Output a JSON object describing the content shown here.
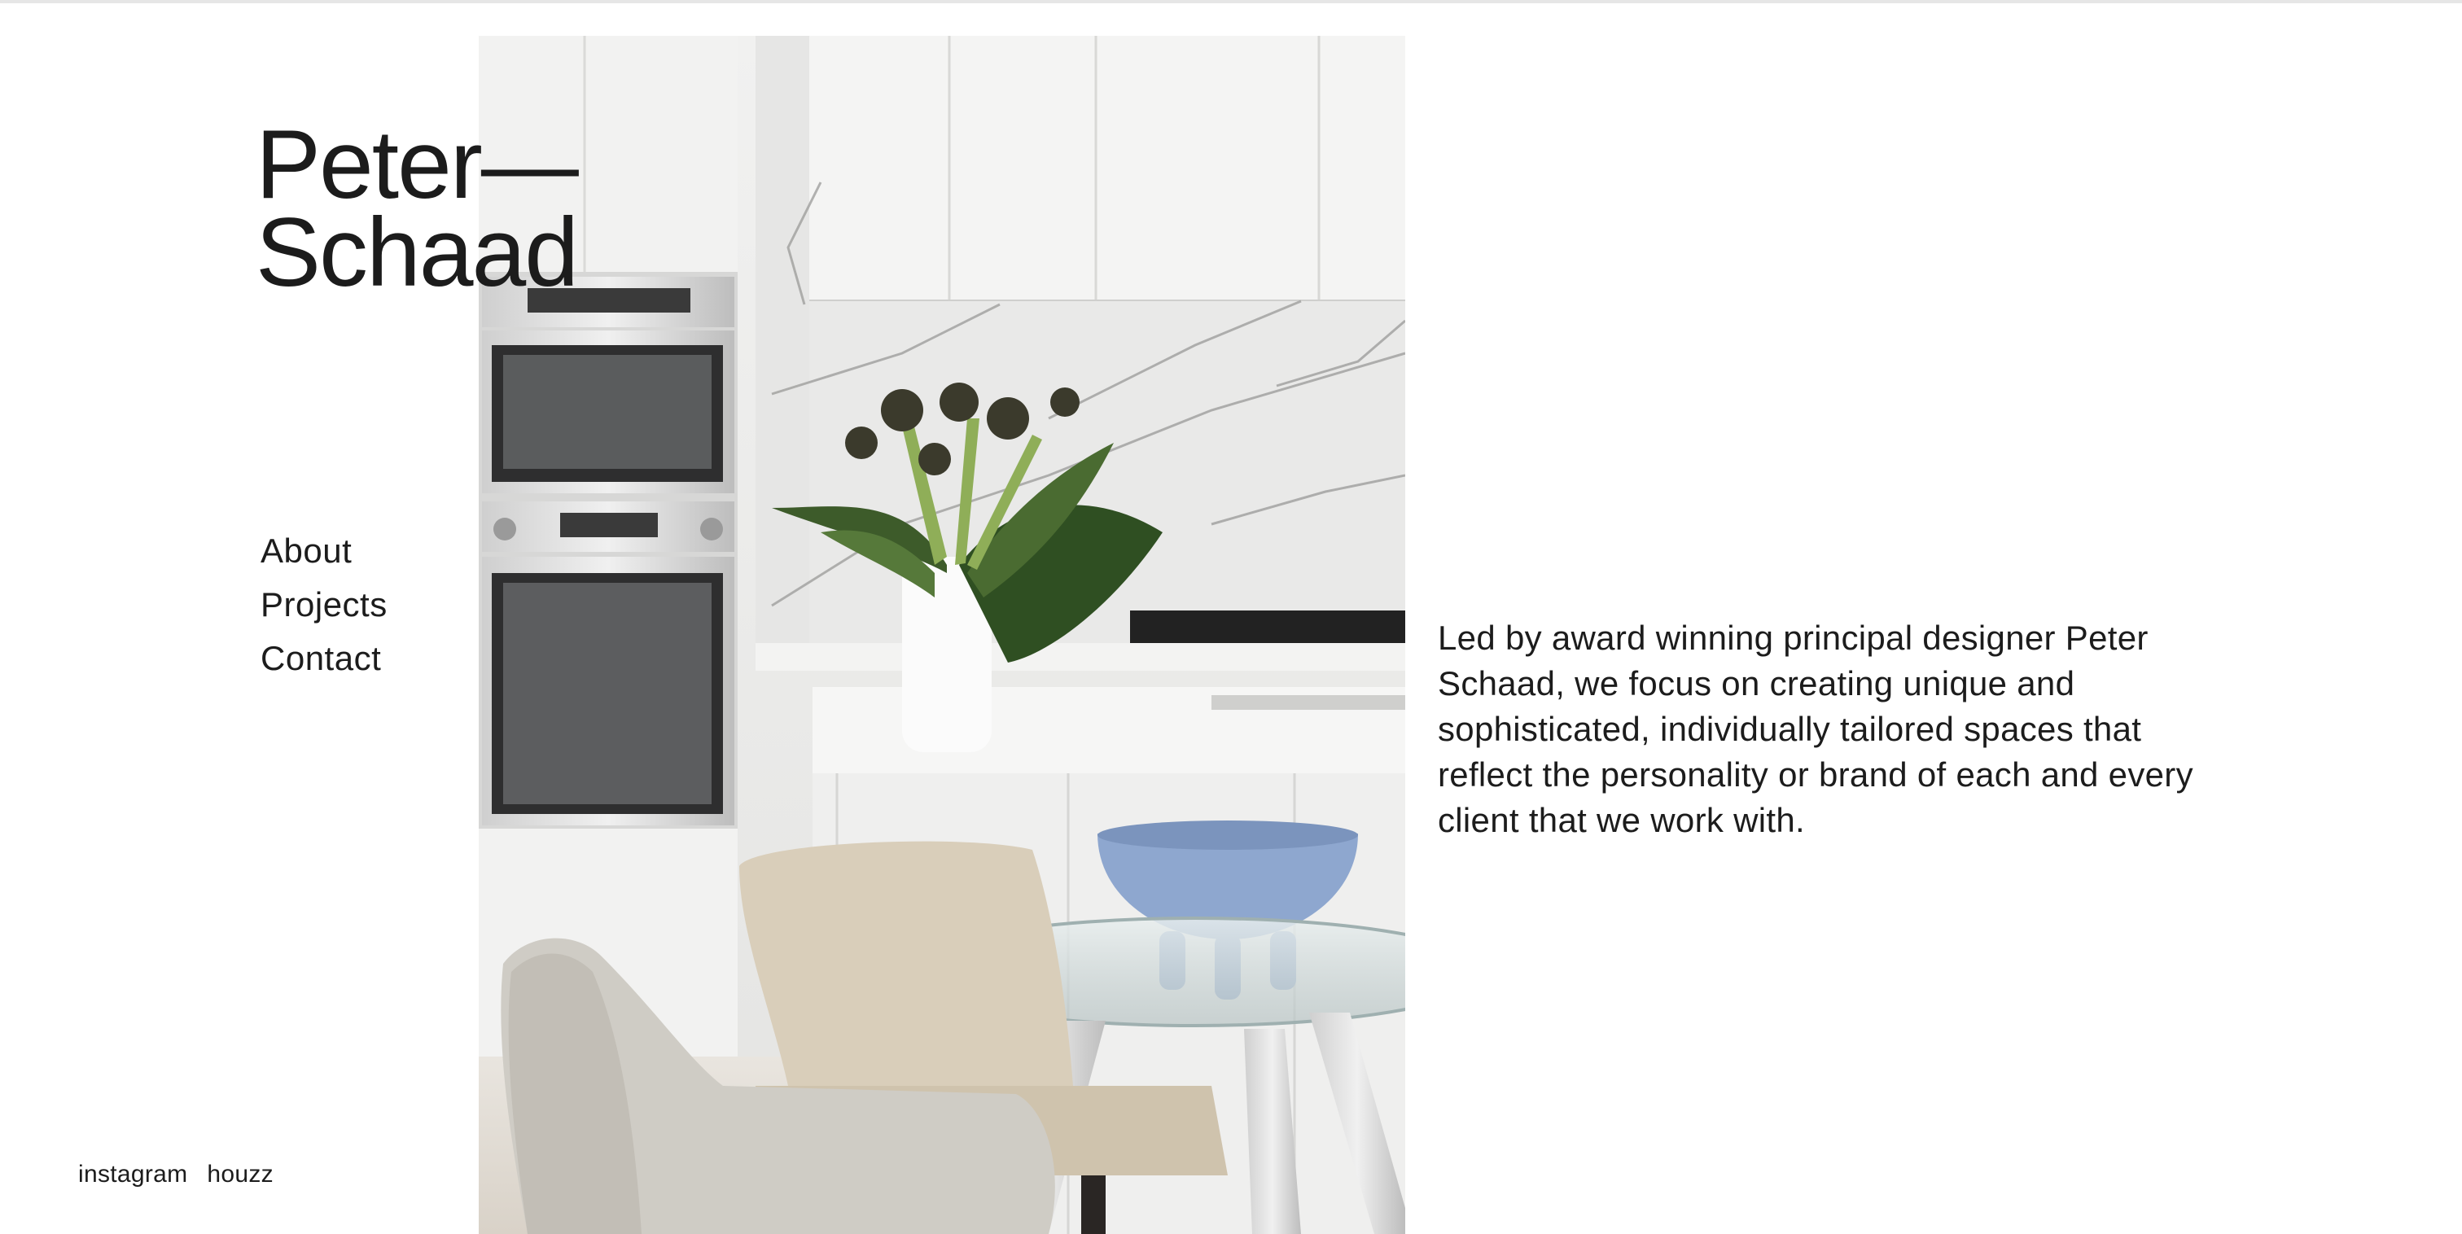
{
  "brand": {
    "line1": "Peter—",
    "line2": "Schaad"
  },
  "nav": {
    "items": [
      {
        "label": "About"
      },
      {
        "label": "Projects"
      },
      {
        "label": "Contact"
      }
    ]
  },
  "social": {
    "items": [
      {
        "label": "instagram"
      },
      {
        "label": "houzz"
      }
    ]
  },
  "intro": {
    "text": "Led by award winning principal designer Peter Schaad, we focus on creating unique and sophisticated, individually tailored spaces that reflect the personality or brand of each and every client that we work with."
  },
  "hero": {
    "subject": "kitchen-dining-interior-photo"
  },
  "colors": {
    "text": "#1c1c1c",
    "background": "#ffffff"
  }
}
